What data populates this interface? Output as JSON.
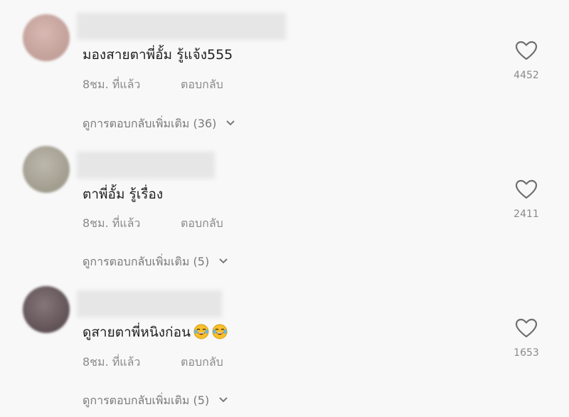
{
  "comments": [
    {
      "text": "มองสายตาพี่อั้ม รู้แจ้ง555",
      "time": "8ชม. ที่แล้ว",
      "reply_label": "ตอบกลับ",
      "more_replies": "ดูการตอบกลับเพิ่มเติม (36)",
      "likes": "4452",
      "avatar_color": "#c9a8a4"
    },
    {
      "text": "ตาพี่อั้ม รู้เรื่อง",
      "time": "8ชม. ที่แล้ว",
      "reply_label": "ตอบกลับ",
      "more_replies": "ดูการตอบกลับเพิ่มเติม (5)",
      "likes": "2411",
      "avatar_color": "#a8a39a"
    },
    {
      "text": "ดูสายตาพี่หนิงก่อน",
      "emojis": [
        "laughing-tears-emoji",
        "laughing-tears-emoji"
      ],
      "time": "8ชม. ที่แล้ว",
      "reply_label": "ตอบกลับ",
      "more_replies": "ดูการตอบกลับเพิ่มเติม (5)",
      "likes": "1653",
      "avatar_color": "#6e5e61"
    }
  ],
  "colors": {
    "background": "#f8f8f8",
    "text": "#1f1f1f",
    "muted": "#8a8a8a"
  }
}
